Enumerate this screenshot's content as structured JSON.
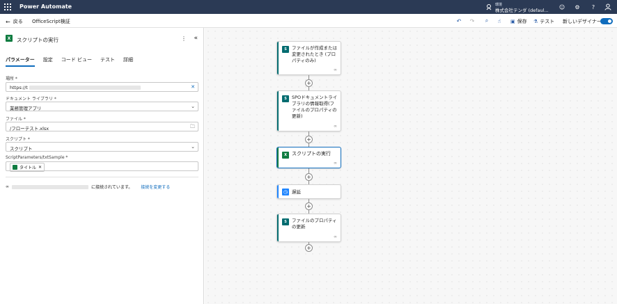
{
  "topbar": {
    "app_name": "Power Automate",
    "environment_label": "環境",
    "environment_name": "株式会社テンダ (defaul...",
    "icons": [
      "environment-icon",
      "emoji-icon",
      "settings-icon",
      "help-icon",
      "account-icon"
    ]
  },
  "commandbar": {
    "back_label": "戻る",
    "flow_name": "OfficeScript検証",
    "save_label": "保存",
    "test_label": "テスト",
    "new_designer_label": "新しいデザイナー",
    "new_designer_on": true
  },
  "panel": {
    "title": "スクリプトの実行",
    "tabs": [
      "パラメーター",
      "設定",
      "コード ビュー",
      "テスト",
      "詳細"
    ],
    "active_tab": "パラメーター",
    "fields": {
      "location": {
        "label": "場所 *",
        "value": "https://t"
      },
      "library": {
        "label": "ドキュメント ライブラリ *",
        "value": "業務管理アプリ"
      },
      "file": {
        "label": "ファイル *",
        "value": "/フローテスト.xlsx"
      },
      "script": {
        "label": "スクリプト *",
        "value": "スクリプト"
      },
      "params": {
        "label": "ScriptParameters/txtSample *",
        "chip": "タイトル"
      }
    },
    "connection": {
      "text": "に接続されています。",
      "change_link": "接続を変更する"
    }
  },
  "flow": {
    "nodes": [
      {
        "text": "ファイルが作成または変更されたとき (プロパティのみ)",
        "kind": "sharepoint",
        "color": "#036c70"
      },
      {
        "text": "SPOドキュメントライブラリの情報取得(ファイルのプロパティの更新)",
        "kind": "sharepoint",
        "color": "#036c70"
      },
      {
        "text": "スクリプトの実行",
        "kind": "excel",
        "color": "#107c41"
      },
      {
        "text": "遅延",
        "kind": "delay",
        "color": "#1f85ff"
      },
      {
        "text": "ファイルのプロパティの更新",
        "kind": "sharepoint",
        "color": "#036c70"
      }
    ]
  }
}
